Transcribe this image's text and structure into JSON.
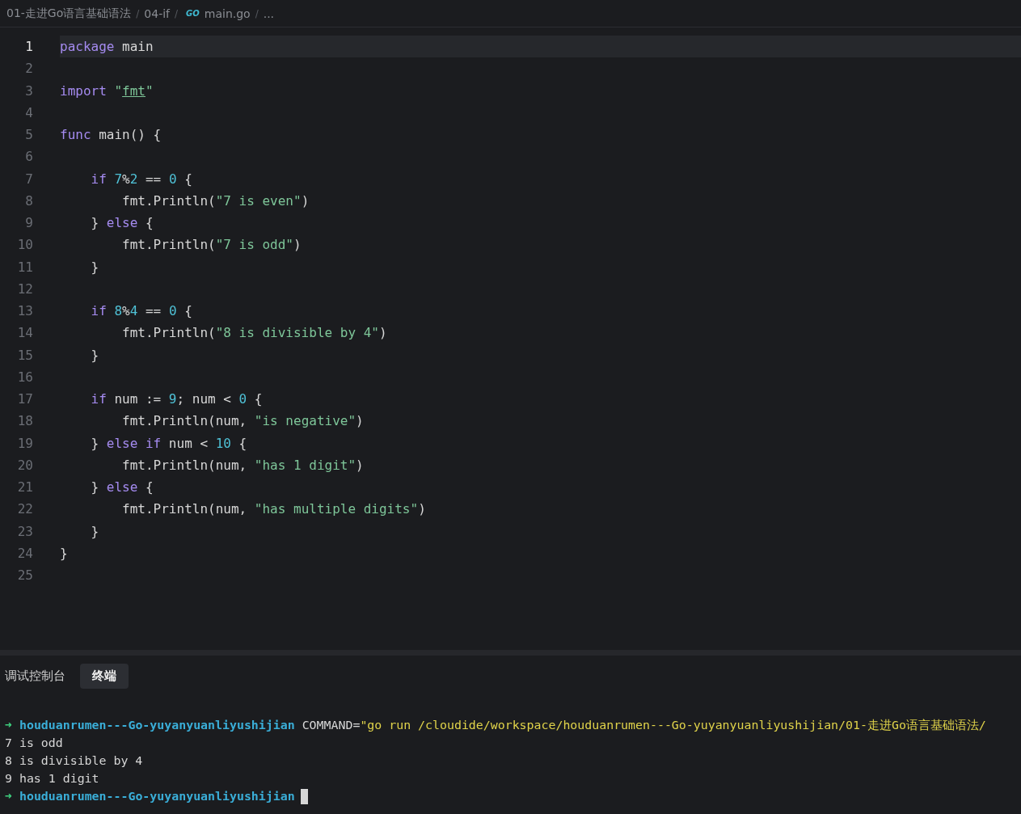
{
  "breadcrumb": [
    {
      "kind": "folder",
      "label": "01-走进Go语言基础语法",
      "separator": "/"
    },
    {
      "kind": "folder",
      "label": "04-if",
      "separator": "/"
    },
    {
      "kind": "file",
      "badge": "GO",
      "label": "main.go",
      "separator": "/"
    },
    {
      "kind": "more",
      "label": "..."
    }
  ],
  "editor": {
    "lines": [
      {
        "number": "1",
        "current": true,
        "tokens": [
          {
            "kind": "keyword",
            "text": "package"
          },
          {
            "kind": "plain",
            "text": " main"
          }
        ]
      },
      {
        "number": "2",
        "current": false
      },
      {
        "number": "3",
        "current": false,
        "tokens": [
          {
            "kind": "keyword",
            "text": "import"
          },
          {
            "kind": "string",
            "text": " \""
          },
          {
            "kind": "link",
            "text": "fmt"
          },
          {
            "kind": "string",
            "text": "\""
          }
        ]
      },
      {
        "number": "4",
        "current": false
      },
      {
        "number": "5",
        "current": false,
        "tokens": [
          {
            "kind": "keyword",
            "text": "func"
          },
          {
            "kind": "plain",
            "text": " main() {"
          }
        ]
      },
      {
        "number": "6",
        "current": false
      },
      {
        "number": "7",
        "current": false,
        "tokens": [
          {
            "kind": "keyword",
            "text": "    if"
          },
          {
            "kind": "number",
            "text": " 7"
          },
          {
            "kind": "plain",
            "text": "%"
          },
          {
            "kind": "number",
            "text": "2"
          },
          {
            "kind": "plain",
            "text": " == "
          },
          {
            "kind": "number",
            "text": "0"
          },
          {
            "kind": "plain",
            "text": " {"
          }
        ]
      },
      {
        "number": "8",
        "current": false,
        "tokens": [
          {
            "kind": "plain",
            "text": "        fmt.Println("
          },
          {
            "kind": "string",
            "text": "\"7 is even\""
          },
          {
            "kind": "plain",
            "text": ")"
          }
        ]
      },
      {
        "number": "9",
        "current": false,
        "tokens": [
          {
            "kind": "plain",
            "text": "    } "
          },
          {
            "kind": "keyword",
            "text": "else"
          },
          {
            "kind": "plain",
            "text": " {"
          }
        ]
      },
      {
        "number": "10",
        "current": false,
        "tokens": [
          {
            "kind": "plain",
            "text": "        fmt.Println("
          },
          {
            "kind": "string",
            "text": "\"7 is odd\""
          },
          {
            "kind": "plain",
            "text": ")"
          }
        ]
      },
      {
        "number": "11",
        "current": false,
        "tokens": [
          {
            "kind": "plain",
            "text": "    }"
          }
        ]
      },
      {
        "number": "12",
        "current": false
      },
      {
        "number": "13",
        "current": false,
        "tokens": [
          {
            "kind": "keyword",
            "text": "    if"
          },
          {
            "kind": "number",
            "text": " 8"
          },
          {
            "kind": "plain",
            "text": "%"
          },
          {
            "kind": "number",
            "text": "4"
          },
          {
            "kind": "plain",
            "text": " == "
          },
          {
            "kind": "number",
            "text": "0"
          },
          {
            "kind": "plain",
            "text": " {"
          }
        ]
      },
      {
        "number": "14",
        "current": false,
        "tokens": [
          {
            "kind": "plain",
            "text": "        fmt.Println("
          },
          {
            "kind": "string",
            "text": "\"8 is divisible by 4\""
          },
          {
            "kind": "plain",
            "text": ")"
          }
        ]
      },
      {
        "number": "15",
        "current": false,
        "tokens": [
          {
            "kind": "plain",
            "text": "    }"
          }
        ]
      },
      {
        "number": "16",
        "current": false
      },
      {
        "number": "17",
        "current": false,
        "tokens": [
          {
            "kind": "keyword",
            "text": "    if"
          },
          {
            "kind": "plain",
            "text": " num := "
          },
          {
            "kind": "number",
            "text": "9"
          },
          {
            "kind": "plain",
            "text": "; num < "
          },
          {
            "kind": "number",
            "text": "0"
          },
          {
            "kind": "plain",
            "text": " {"
          }
        ]
      },
      {
        "number": "18",
        "current": false,
        "tokens": [
          {
            "kind": "plain",
            "text": "        fmt.Println(num, "
          },
          {
            "kind": "string",
            "text": "\"is negative\""
          },
          {
            "kind": "plain",
            "text": ")"
          }
        ]
      },
      {
        "number": "19",
        "current": false,
        "tokens": [
          {
            "kind": "plain",
            "text": "    } "
          },
          {
            "kind": "keyword",
            "text": "else"
          },
          {
            "kind": "keyword",
            "text": " if"
          },
          {
            "kind": "plain",
            "text": " num < "
          },
          {
            "kind": "number",
            "text": "10"
          },
          {
            "kind": "plain",
            "text": " {"
          }
        ]
      },
      {
        "number": "20",
        "current": false,
        "tokens": [
          {
            "kind": "plain",
            "text": "        fmt.Println(num, "
          },
          {
            "kind": "string",
            "text": "\"has 1 digit\""
          },
          {
            "kind": "plain",
            "text": ")"
          }
        ]
      },
      {
        "number": "21",
        "current": false,
        "tokens": [
          {
            "kind": "plain",
            "text": "    } "
          },
          {
            "kind": "keyword",
            "text": "else"
          },
          {
            "kind": "plain",
            "text": " {"
          }
        ]
      },
      {
        "number": "22",
        "current": false,
        "tokens": [
          {
            "kind": "plain",
            "text": "        fmt.Println(num, "
          },
          {
            "kind": "string",
            "text": "\"has multiple digits\""
          },
          {
            "kind": "plain",
            "text": ")"
          }
        ]
      },
      {
        "number": "23",
        "current": false,
        "tokens": [
          {
            "kind": "plain",
            "text": "    }"
          }
        ]
      },
      {
        "number": "24",
        "current": false,
        "tokens": [
          {
            "kind": "plain",
            "text": "}"
          }
        ]
      },
      {
        "number": "25",
        "current": false
      }
    ]
  },
  "panel": {
    "tabs": [
      {
        "label": "调试控制台",
        "selected": false
      },
      {
        "label": "终端",
        "selected": true
      }
    ],
    "terminal": [
      {
        "kind": "prompt",
        "arrow": "➜",
        "directory": "houduanrumen---Go-yuyanyuanliyushijian",
        "command_name": "COMMAND=",
        "command_value": "\"go run /cloudide/workspace/houduanrumen---Go-yuyanyuanliyushijian/01-走进Go语言基础语法/",
        "cursor": false
      },
      {
        "kind": "output",
        "text": "7 is odd"
      },
      {
        "kind": "output",
        "text": "8 is divisible by 4"
      },
      {
        "kind": "output",
        "text": "9 has 1 digit"
      },
      {
        "kind": "prompt",
        "arrow": "➜",
        "directory": "houduanrumen---Go-yuyanyuanliyushijian",
        "cursor": true
      }
    ]
  }
}
